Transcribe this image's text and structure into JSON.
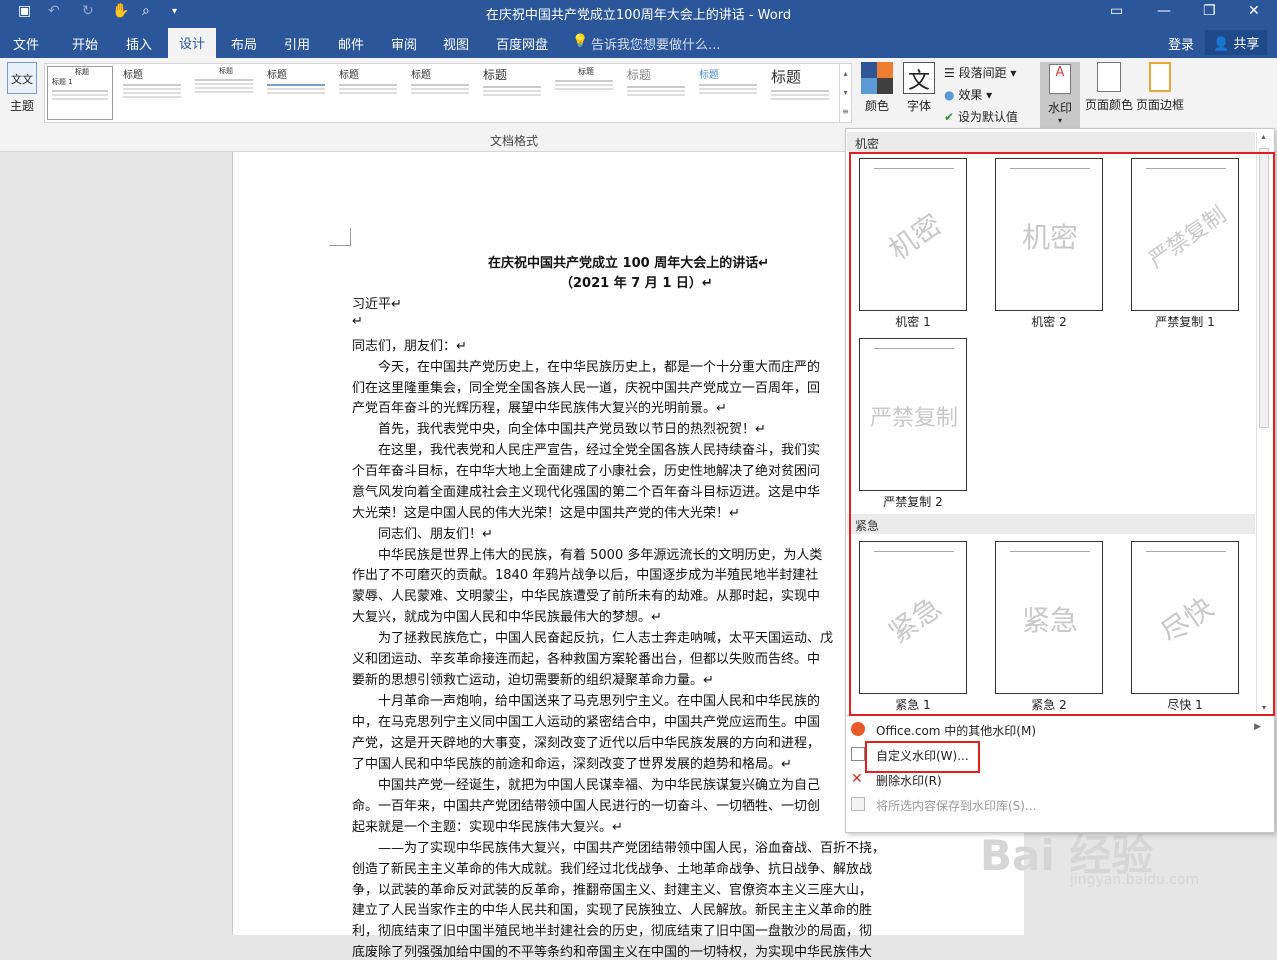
{
  "window": {
    "title": "在庆祝中国共产党成立100周年大会上的讲话 - Word"
  },
  "tabs": [
    "文件",
    "开始",
    "插入",
    "设计",
    "布局",
    "引用",
    "邮件",
    "审阅",
    "视图",
    "百度网盘"
  ],
  "tell_me": "告诉我您想要做什么...",
  "account": {
    "login": "登录",
    "share": "共享"
  },
  "ribbon": {
    "theme_label": "主题",
    "gallery_caption": "文档格式",
    "gallery_items": [
      {
        "head": "标题"
      },
      {
        "head": "标题"
      },
      {
        "head": "标题"
      },
      {
        "head": "标题"
      },
      {
        "head": "标题"
      },
      {
        "head": "标题"
      },
      {
        "head": "标题"
      },
      {
        "head": "标题"
      },
      {
        "head": "标题"
      },
      {
        "head": "标题"
      },
      {
        "head": "标题"
      }
    ],
    "colors_label": "颜色",
    "fonts_label": "字体",
    "fonts_icon_text": "文",
    "paragraph_spacing": "段落间距",
    "effects": "效果",
    "set_default": "设为默认值",
    "watermark": "水印",
    "page_color": "页面颜色",
    "page_border": "页面边框"
  },
  "document": {
    "lines": [
      "在庆祝中国共产党成立 100 周年大会上的讲话↵",
      "（2021 年 7 月 1 日）↵",
      "习近平↵",
      "↵",
      "同志们，朋友们：↵",
      "　　今天，在中国共产党历史上，在中华民族历史上，都是一个十分重大而庄严的",
      "们在这里隆重集会，同全党全国各族人民一道，庆祝中国共产党成立一百周年，回",
      "产党百年奋斗的光辉历程，展望中华民族伟大复兴的光明前景。↵",
      "　　首先，我代表党中央，向全体中国共产党员致以节日的热烈祝贺！↵",
      "　　在这里，我代表党和人民庄严宣告，经过全党全国各族人民持续奋斗，我们实",
      "个百年奋斗目标，在中华大地上全面建成了小康社会，历史性地解决了绝对贫困问",
      "意气风发向着全面建成社会主义现代化强国的第二个百年奋斗目标迈进。这是中华",
      "大光荣！这是中国人民的伟大光荣！这是中国共产党的伟大光荣！↵",
      "　　同志们、朋友们！↵",
      "　　中华民族是世界上伟大的民族，有着 5000 多年源远流长的文明历史，为人类",
      "作出了不可磨灭的贡献。1840 年鸦片战争以后，中国逐步成为半殖民地半封建社",
      "蒙辱、人民蒙难、文明蒙尘，中华民族遭受了前所未有的劫难。从那时起，实现中",
      "大复兴，就成为中国人民和中华民族最伟大的梦想。↵",
      "　　为了拯救民族危亡，中国人民奋起反抗，仁人志士奔走呐喊，太平天国运动、戊",
      "义和团运动、辛亥革命接连而起，各种救国方案轮番出台，但都以失败而告终。中",
      "要新的思想引领救亡运动，迫切需要新的组织凝聚革命力量。↵",
      "　　十月革命一声炮响，给中国送来了马克思列宁主义。在中国人民和中华民族的",
      "中，在马克思列宁主义同中国工人运动的紧密结合中，中国共产党应运而生。中国",
      "产党，这是开天辟地的大事变，深刻改变了近代以后中华民族发展的方向和进程，",
      "了中国人民和中华民族的前途和命运，深刻改变了世界发展的趋势和格局。↵",
      "　　中国共产党一经诞生，就把为中国人民谋幸福、为中华民族谋复兴确立为自己",
      "命。一百年来，中国共产党团结带领中国人民进行的一切奋斗、一切牺牲、一切创",
      "起来就是一个主题：实现中华民族伟大复兴。↵",
      "　　——为了实现中华民族伟大复兴，中国共产党团结带领中国人民，浴血奋战、百折不挠，",
      "创造了新民主主义革命的伟大成就。我们经过北伐战争、土地革命战争、抗日战争、解放战",
      "争，以武装的革命反对武装的反革命，推翻帝国主义、封建主义、官僚资本主义三座大山，",
      "建立了人民当家作主的中华人民共和国，实现了民族独立、人民解放。新民主主义革命的胜",
      "利，彻底结束了旧中国半殖民地半封建社会的历史，彻底结束了旧中国一盘散沙的局面，彻",
      "底废除了列强强加给中国的不平等条约和帝国主义在中国的一切特权，为实现中华民族伟大"
    ]
  },
  "watermark_panel": {
    "section1": "机密",
    "section2": "紧急",
    "items": [
      {
        "text": "机密",
        "label": "机密 1"
      },
      {
        "text": "机密",
        "label": "机密 2"
      },
      {
        "text": "严禁复制",
        "label": "严禁复制 1"
      },
      {
        "text": "严禁复制",
        "label": "严禁复制 2"
      },
      {
        "text": "紧急",
        "label": "紧急 1"
      },
      {
        "text": "紧急",
        "label": "紧急 2"
      },
      {
        "text": "尽快",
        "label": "尽快 1"
      }
    ],
    "menu": {
      "more": "Office.com 中的其他水印(M)",
      "custom": "自定义水印(W)...",
      "remove": "删除水印(R)",
      "save": "将所选内容保存到水印库(S)..."
    }
  },
  "brand_watermark": {
    "main": "Bai 经验",
    "sub": "jingyan.baidu.com"
  },
  "colors": {
    "titlebar": "#2b579a",
    "highlight": "#e02020"
  }
}
